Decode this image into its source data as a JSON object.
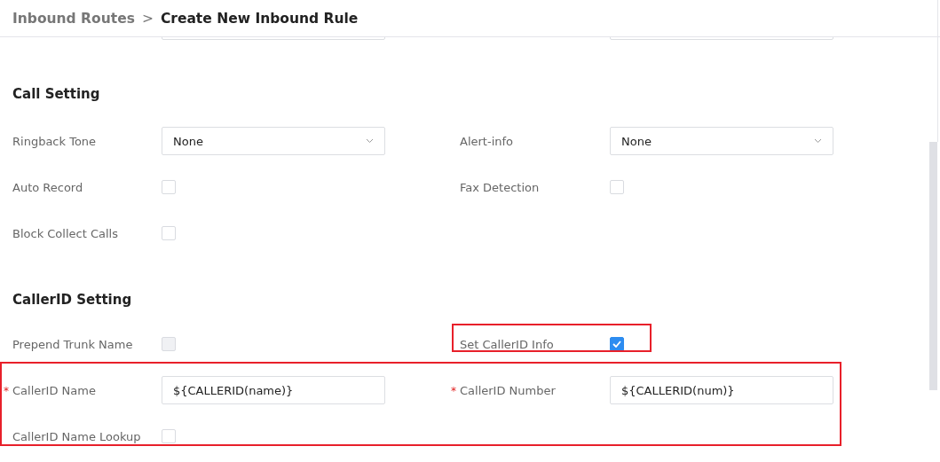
{
  "breadcrumb": {
    "parent": "Inbound Routes",
    "separator": ">",
    "current": "Create New Inbound Rule"
  },
  "clipped_row": {
    "fields": [
      {
        "kind": "text"
      },
      {
        "kind": "text"
      }
    ]
  },
  "sections": [
    {
      "title": "Call Setting",
      "rows": [
        {
          "highlighted": false,
          "fields": [
            {
              "kind": "select",
              "label": "Ringback Tone",
              "value": "None"
            },
            {
              "kind": "select",
              "label": "Alert-info",
              "value": "None"
            }
          ]
        },
        {
          "highlighted": false,
          "fields": [
            {
              "kind": "checkbox",
              "label": "Auto Record",
              "checked": false,
              "disabled": false
            },
            {
              "kind": "checkbox",
              "label": "Fax Detection",
              "checked": false,
              "disabled": false
            }
          ]
        },
        {
          "highlighted": false,
          "fields": [
            {
              "kind": "checkbox",
              "label": "Block Collect Calls",
              "checked": false,
              "disabled": false
            }
          ]
        }
      ]
    },
    {
      "title": "CallerID Setting",
      "rows": [
        {
          "highlighted": false,
          "fields": [
            {
              "kind": "checkbox",
              "label": "Prepend Trunk Name",
              "checked": false,
              "disabled": true
            },
            {
              "kind": "checkbox",
              "label": "Set CallerID Info",
              "checked": true,
              "disabled": false,
              "highlighted": true
            }
          ]
        },
        {
          "highlighted": true,
          "fields": [
            {
              "kind": "text",
              "label": "CallerID Name",
              "required_mark": "*",
              "value": "${CALLERID(name)}"
            },
            {
              "kind": "text",
              "label": "CallerID Number",
              "required_mark": "*",
              "value": "${CALLERID(num)}"
            }
          ]
        },
        {
          "highlighted": true,
          "fields": [
            {
              "kind": "checkbox",
              "label": "CallerID Name Lookup",
              "checked": false,
              "disabled": false
            }
          ]
        }
      ]
    }
  ]
}
